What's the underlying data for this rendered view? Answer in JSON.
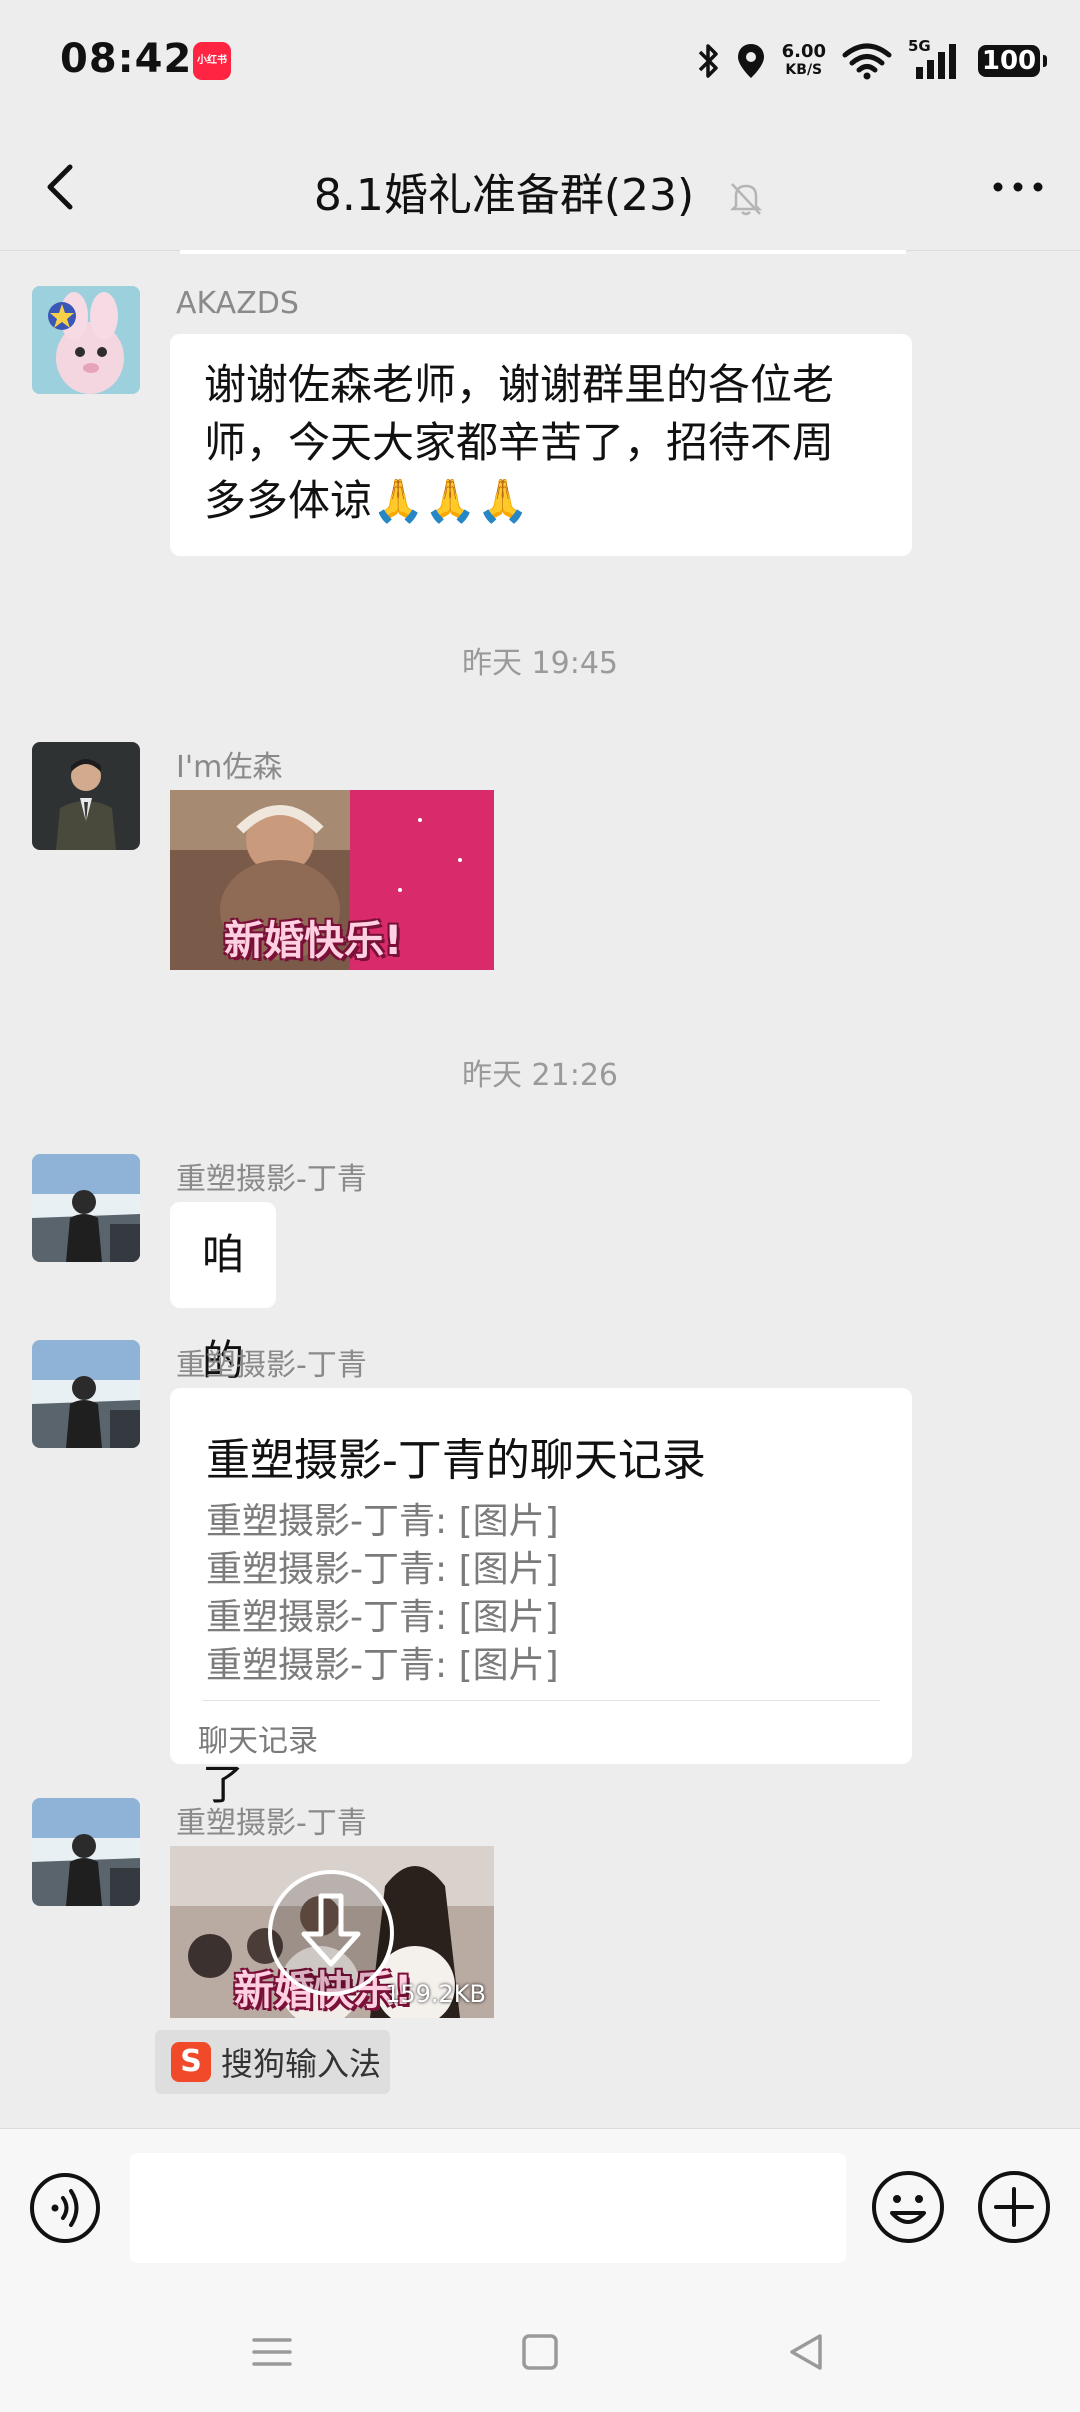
{
  "status_bar": {
    "time": "08:42",
    "app_badge": "小红书",
    "net_speed": "6.00",
    "net_speed_unit": "KB/S",
    "network": "5G",
    "battery": "100"
  },
  "header": {
    "title": "8.1婚礼准备群(23)"
  },
  "messages": [
    {
      "sender": "AKAZDS",
      "text_lines": [
        "谢谢佐森老师，谢谢群里的各位老",
        "师，今天大家都辛苦了，招待不周",
        "多多体谅🙏🙏🙏"
      ]
    },
    {
      "timestamp": "昨天 19:45"
    },
    {
      "sender": "I'm佐森",
      "sticker_text": "新婚快乐!"
    },
    {
      "timestamp": "昨天 21:26"
    },
    {
      "sender": "重塑摄影-丁青",
      "text": "咱的预告好了哈"
    },
    {
      "sender": "重塑摄影-丁青",
      "card": {
        "title": "重塑摄影-丁青的聊天记录",
        "lines": [
          "重塑摄影-丁青: [图片]",
          "重塑摄影-丁青: [图片]",
          "重塑摄影-丁青: [图片]",
          "重塑摄影-丁青: [图片]"
        ],
        "footer": "聊天记录"
      }
    },
    {
      "sender": "重塑摄影-丁青",
      "sticker_text": "新婚快乐!",
      "file_size": "159.2KB"
    }
  ],
  "ime_badge": {
    "logo": "S",
    "label": "搜狗输入法"
  },
  "colors": {
    "background": "#ededed",
    "bubble": "#ffffff",
    "accent_badge": "#ff2442",
    "sogou": "#f04a2b"
  },
  "icons": {
    "back": "chevron-left-icon",
    "mute": "bell-off-icon",
    "more": "more-dots-icon",
    "voice": "voice-icon",
    "emoji": "smiley-icon",
    "plus": "plus-icon",
    "download": "download-icon"
  }
}
